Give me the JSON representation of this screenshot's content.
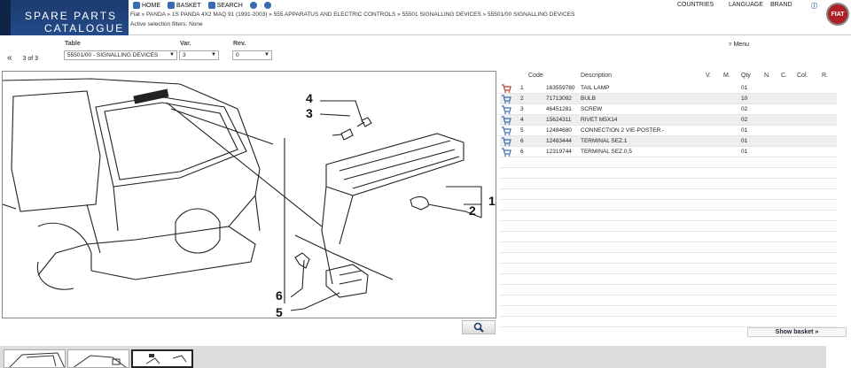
{
  "logo": {
    "line1": "SPARE PARTS",
    "line2": "CATALOGUE"
  },
  "nav": {
    "home": "HOME",
    "basket": "BASKET",
    "search": "SEARCH"
  },
  "top_links": {
    "countries": "COUNTRIES",
    "language": "LANGUAGE",
    "brand": "BRAND"
  },
  "breadcrumb": "Fiat » PANDA » 1S PANDA 4X2 MAQ 91 (1991-2003) » 555 APPARATUS AND ELECTRIC CONTROLS » 55501 SIGNALLING DEVICES » 55501/00 SIGNALLING DEVICES",
  "filters": "Active selection filters: None",
  "brand_logo_text": "FIAT",
  "selectors": {
    "pager": "3 of 3",
    "table_label": "Table",
    "table_value": "55501/00 - SIGNALLING DEVICES",
    "var_label": "Var.",
    "var_value": "3",
    "rev_label": "Rev.",
    "rev_value": "0",
    "menu": "Menu"
  },
  "drawing": {
    "callouts": [
      "1",
      "2",
      "3",
      "4",
      "5",
      "6"
    ]
  },
  "table": {
    "headers": {
      "code": "Code",
      "description": "Description",
      "v": "V.",
      "m": "M.",
      "qty": "Qty",
      "n": "N.",
      "c": "C.",
      "col": "Col.",
      "r": "R."
    },
    "rows": [
      {
        "num": "1",
        "code": "183559780",
        "desc": "TAIL LAMP",
        "qty": "01"
      },
      {
        "num": "2",
        "code": "71713092",
        "desc": "BULB",
        "qty": "10"
      },
      {
        "num": "3",
        "code": "46451281",
        "desc": "SCREW",
        "qty": "02"
      },
      {
        "num": "4",
        "code": "15624311",
        "desc": "RIVET M5X14",
        "qty": "02"
      },
      {
        "num": "5",
        "code": "12484680",
        "desc": "CONNECTION 2 VIE-POSTER.-",
        "qty": "01"
      },
      {
        "num": "6",
        "code": "12483444",
        "desc": "TERMINAL SEZ.1",
        "qty": "01"
      },
      {
        "num": "6",
        "code": "12319744",
        "desc": "TERMINAL SEZ.0,5",
        "qty": "01"
      }
    ]
  },
  "show_basket": "Show basket »",
  "colors": {
    "logo_blue": "#1c3a6e",
    "brand_red": "#b01f24",
    "cart_blue": "#3a6ab0",
    "cart_red": "#c0392b"
  }
}
